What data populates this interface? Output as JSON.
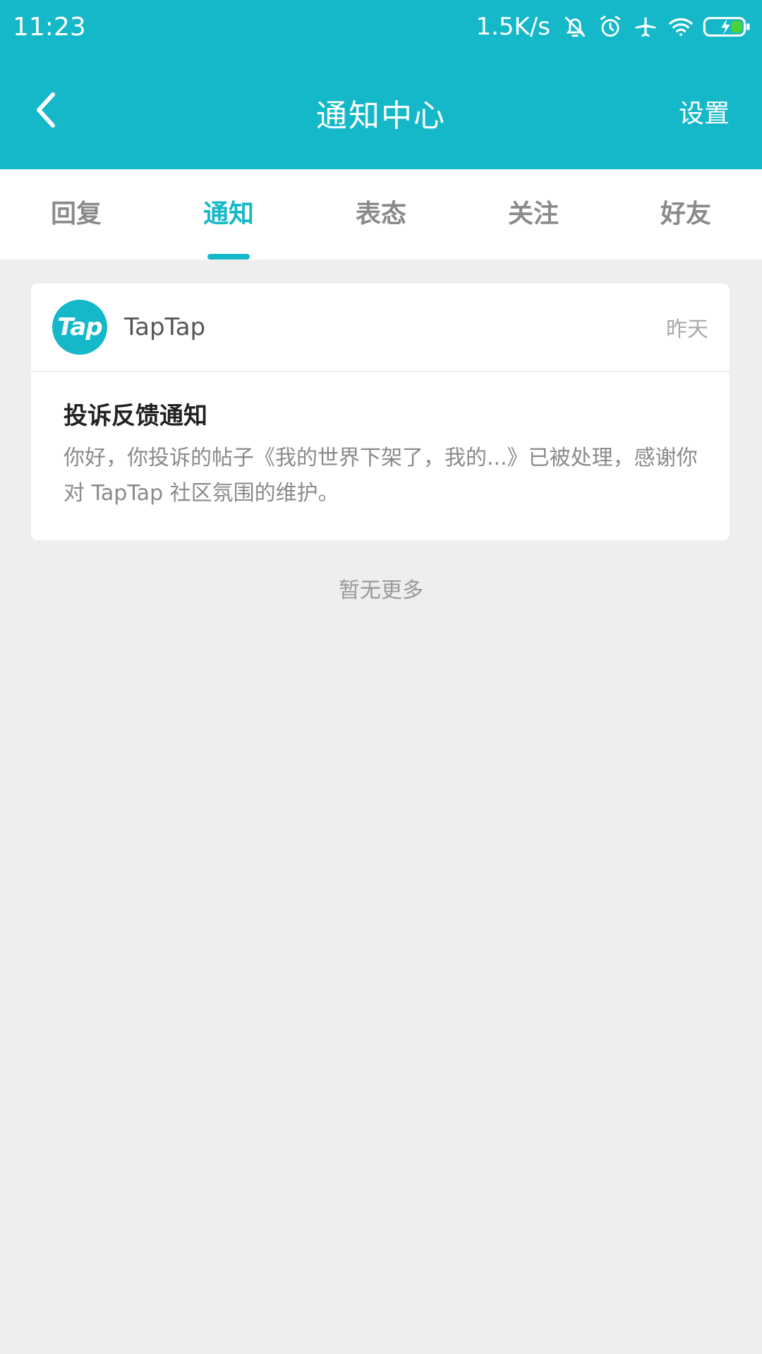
{
  "status_bar": {
    "time": "11:23",
    "net_speed": "1.5K/s",
    "icons": [
      "bell-off-icon",
      "alarm-icon",
      "airplane-icon",
      "wifi-icon",
      "battery-charging-icon"
    ]
  },
  "toolbar": {
    "title": "通知中心",
    "settings_label": "设置",
    "back_icon": "chevron-left-icon"
  },
  "tabs": [
    {
      "label": "回复",
      "active": false
    },
    {
      "label": "通知",
      "active": true
    },
    {
      "label": "表态",
      "active": false
    },
    {
      "label": "关注",
      "active": false
    },
    {
      "label": "好友",
      "active": false
    }
  ],
  "notifications": [
    {
      "sender": "TapTap",
      "avatar_text": "Tap",
      "time": "昨天",
      "title": "投诉反馈通知",
      "content": "你好，你投诉的帖子《我的世界下架了，我的...》已被处理，感谢你对 TapTap 社区氛围的维护。"
    }
  ],
  "footer": {
    "no_more": "暂无更多"
  },
  "colors": {
    "primary": "#15b8c8",
    "background": "#eeeeee",
    "battery_fill": "#4cd137"
  }
}
